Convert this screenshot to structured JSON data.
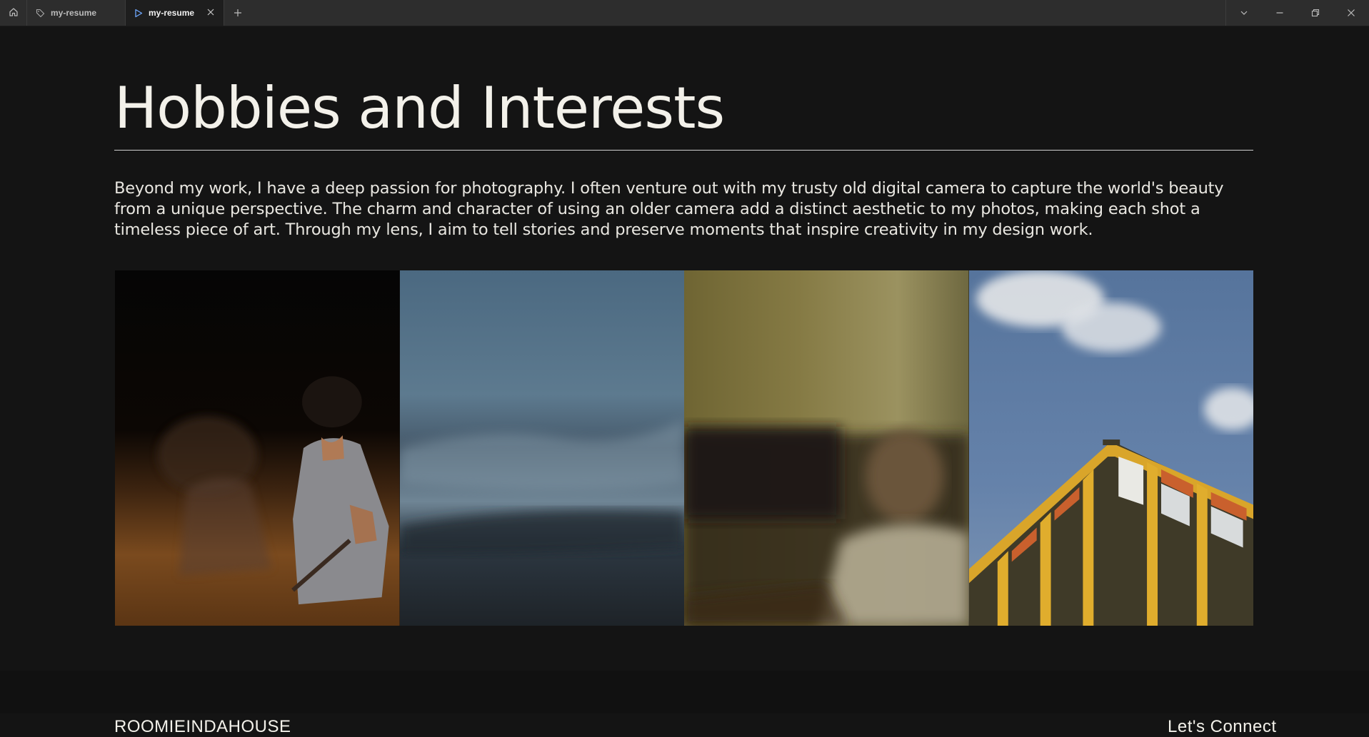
{
  "titlebar": {
    "home_icon": "home-icon",
    "tabs": [
      {
        "label": "my-resume",
        "icon": "tag-icon",
        "active": false
      },
      {
        "label": "my-resume",
        "icon": "play-icon",
        "active": true,
        "close_icon": "close-icon"
      }
    ],
    "new_tab_icon": "plus-icon",
    "controls": [
      "chevron-down-icon",
      "minimize-icon",
      "restore-icon",
      "close-icon"
    ]
  },
  "main": {
    "heading": "Hobbies and Interests",
    "intro": "Beyond my work, I have a deep passion for photography. I often venture out with my trusty old digital camera to capture the world's beauty from a unique perspective. The charm and character of using an older camera add a distinct aesthetic to my photos, making each shot a timeless piece of art. Through my lens, I aim to tell stories and preserve moments that inspire creativity in my design work.",
    "photos": [
      {
        "subject": "night-portrait-photo",
        "tone": "#5a3a1a"
      },
      {
        "subject": "blurred-sea-photo",
        "tone": "#4f6a80"
      },
      {
        "subject": "blurred-room-portrait-photo",
        "tone": "#6e6035"
      },
      {
        "subject": "yellow-building-sky-photo",
        "tone": "#5c7aa0"
      }
    ]
  },
  "footer": {
    "brand": "ROOMIEINDAHOUSE",
    "contact": "Let's Connect"
  }
}
